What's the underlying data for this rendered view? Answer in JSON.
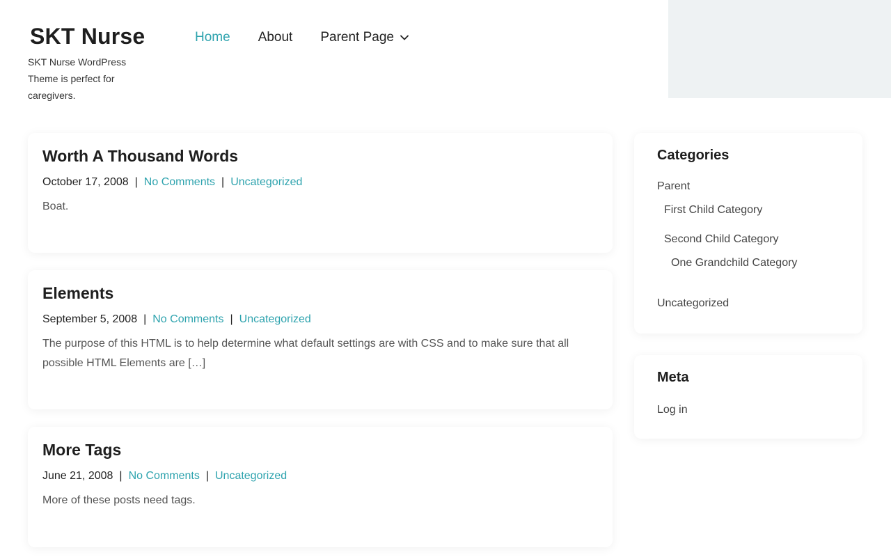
{
  "site": {
    "title": "SKT Nurse",
    "description": "SKT Nurse WordPress Theme is perfect for caregivers."
  },
  "nav": {
    "items": [
      {
        "label": "Home",
        "active": true
      },
      {
        "label": "About",
        "active": false
      },
      {
        "label": "Parent Page",
        "active": false,
        "has_dropdown": true
      }
    ]
  },
  "posts": [
    {
      "title": "Worth A Thousand Words",
      "date": "October 17, 2008",
      "comments": "No Comments",
      "category": "Uncategorized",
      "excerpt": "Boat."
    },
    {
      "title": "Elements",
      "date": "September 5, 2008",
      "comments": "No Comments",
      "category": "Uncategorized",
      "excerpt": "The purpose of this HTML is to help determine what default settings are with CSS and to make sure that all possible HTML Elements are […]"
    },
    {
      "title": "More Tags",
      "date": "June 21, 2008",
      "comments": "No Comments",
      "category": "Uncategorized",
      "excerpt": "More of these posts need tags."
    }
  ],
  "meta_separator": "|",
  "sidebar": {
    "categories": {
      "title": "Categories",
      "parent": "Parent",
      "first_child": "First Child Category",
      "second_child": "Second Child Category",
      "grandchild": "One Grandchild Category",
      "uncategorized": "Uncategorized"
    },
    "meta": {
      "title": "Meta",
      "login": "Log in"
    }
  },
  "colors": {
    "accent": "#2ea3ae",
    "header_panel": "#eef2f3"
  }
}
